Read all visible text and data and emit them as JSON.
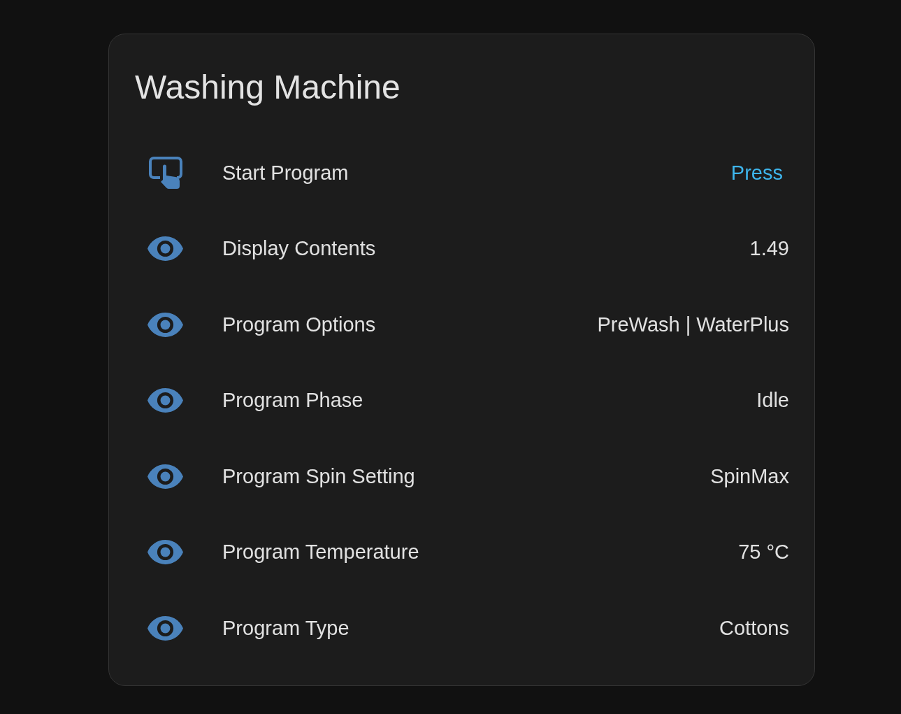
{
  "card": {
    "title": "Washing Machine",
    "entities": [
      {
        "kind": "button",
        "name": "Start Program",
        "action": "Press"
      },
      {
        "kind": "sensor",
        "name": "Display Contents",
        "value": "1.49"
      },
      {
        "kind": "sensor",
        "name": "Program Options",
        "value": "PreWash | WaterPlus"
      },
      {
        "kind": "sensor",
        "name": "Program Phase",
        "value": "Idle"
      },
      {
        "kind": "sensor",
        "name": "Program Spin Setting",
        "value": "SpinMax"
      },
      {
        "kind": "sensor",
        "name": "Program Temperature",
        "value": "75 °C"
      },
      {
        "kind": "sensor",
        "name": "Program Type",
        "value": "Cottons"
      }
    ]
  }
}
